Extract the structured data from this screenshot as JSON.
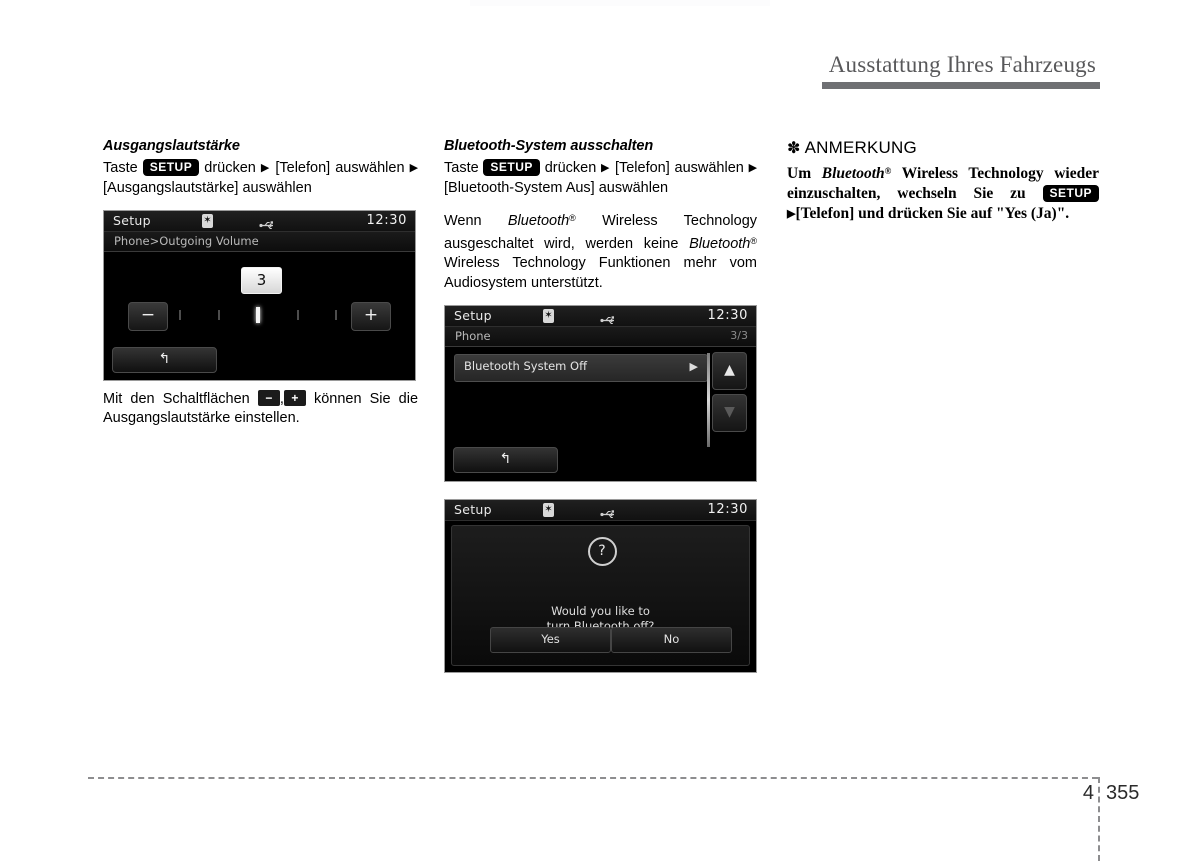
{
  "header": {
    "title": "Ausstattung Ihres Fahrzeugs"
  },
  "footer": {
    "chapter": "4",
    "page": "355"
  },
  "column_left": {
    "section_title": "Ausgangslautstärke",
    "instruction": {
      "before_badge": "Taste",
      "badge": "SETUP",
      "after_badge": "drücken",
      "arrow": "▶",
      "step1": "[Telefon] auswählen",
      "arrow2": "▶",
      "step2": "[Ausgangslautstärke] auswählen"
    },
    "device": {
      "status": {
        "title": "Setup",
        "bluetooth_icon": "bluetooth-icon",
        "usb_icon": "usb-icon",
        "time": "12:30"
      },
      "breadcrumb": "Phone>Outgoing Volume",
      "volume_value": "3",
      "minus_label": "−",
      "plus_label": "+",
      "tick_count": 5,
      "active_tick": 3,
      "back_label": "↰"
    },
    "caption": {
      "part1": "Mit den Schaltflächen",
      "key_minus": "−",
      "comma": ",",
      "key_plus": "+",
      "part2": "können Sie die Ausgangslautstärke einstellen."
    }
  },
  "column_middle": {
    "section_title": "Bluetooth-System ausschalten",
    "instruction": {
      "before_badge": "Taste",
      "badge": "SETUP",
      "after_badge": "drücken",
      "arrow": "▶",
      "step1": "[Telefon] auswählen",
      "arrow2": "▶",
      "step2": "[Bluetooth-System Aus] auswählen"
    },
    "paragraph": {
      "t1": "Wenn",
      "bt1": "Bluetooth",
      "reg1": "®",
      "t2": "Wireless Technology ausgeschaltet wird, werden keine",
      "bt2": "Bluetooth",
      "reg2": "®",
      "t3": "Wireless Technology Funktionen mehr vom Audiosystem unterstützt."
    },
    "device_list": {
      "status": {
        "title": "Setup",
        "bluetooth_icon": "bluetooth-icon",
        "usb_icon": "usb-icon",
        "time": "12:30"
      },
      "breadcrumb": "Phone",
      "page_indicator": "3/3",
      "item_label": "Bluetooth System Off",
      "item_arrow": "▶",
      "scroll_up": "▲",
      "scroll_down": "▼",
      "back_label": "↰"
    },
    "device_dialog": {
      "status": {
        "title": "Setup",
        "bluetooth_icon": "bluetooth-icon",
        "usb_icon": "usb-icon",
        "time": "12:30"
      },
      "question_icon": "?",
      "message_line1": "Would you like to",
      "message_line2": "turn Bluetooth off?",
      "yes_label": "Yes",
      "no_label": "No"
    }
  },
  "column_right": {
    "note_star": "✽",
    "note_title": "ANMERKUNG",
    "note_body": {
      "t1": "Um",
      "bt": "Bluetooth",
      "reg": "®",
      "t2": "Wireless Technology wieder einzuschalten, wechseln Sie zu",
      "badge": "SETUP",
      "arrow": "▶",
      "t3": "[Telefon] und drücken Sie auf \"Yes (Ja)\"."
    }
  },
  "colors": {
    "header_rule": "#6f7073",
    "header_text": "#58585a",
    "badge_bg": "#000000",
    "screen_bg": "#000000"
  }
}
